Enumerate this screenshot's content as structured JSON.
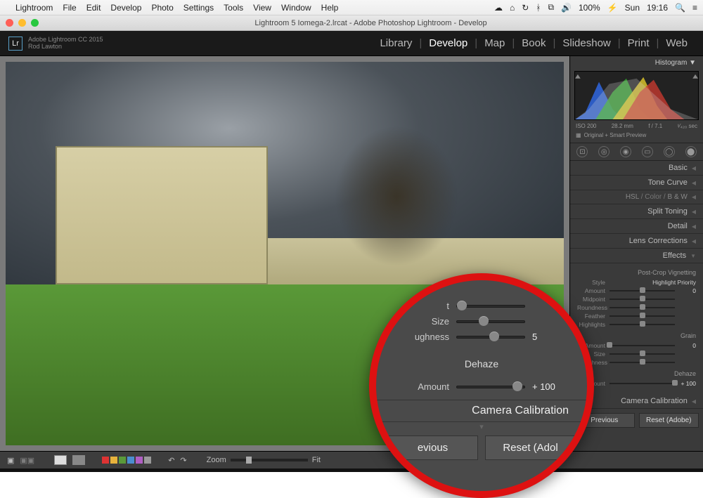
{
  "menubar": {
    "app": "Lightroom",
    "items": [
      "File",
      "Edit",
      "Develop",
      "Photo",
      "Settings",
      "Tools",
      "View",
      "Window",
      "Help"
    ],
    "status": {
      "battery": "100%",
      "battery_icon": "⚡",
      "day": "Sun",
      "time": "19:16"
    }
  },
  "window": {
    "title": "Lightroom 5 Iomega-2.lrcat - Adobe Photoshop Lightroom - Develop"
  },
  "identity": {
    "product_line": "Adobe Lightroom CC 2015",
    "user": "Rod Lawton",
    "logo_text": "Lr"
  },
  "modules": {
    "items": [
      "Library",
      "Develop",
      "Map",
      "Book",
      "Slideshow",
      "Print",
      "Web"
    ],
    "active": "Develop"
  },
  "right_panel": {
    "histogram": {
      "title": "Histogram",
      "meta": {
        "iso": "ISO 200",
        "focal": "28.2 mm",
        "aperture": "f / 7.1",
        "shutter": "¹⁄₄₂₀ sec"
      },
      "sub": "Original + Smart Preview"
    },
    "sections": [
      {
        "label": "Basic"
      },
      {
        "label": "Tone Curve"
      },
      {
        "label_prefix": "HSL",
        "label_mid": " / Color / ",
        "label_suffix": "B & W"
      },
      {
        "label": "Split Toning"
      },
      {
        "label": "Detail"
      },
      {
        "label": "Lens Corrections"
      }
    ],
    "effects": {
      "title": "Effects",
      "vignette": {
        "heading": "Post-Crop Vignetting",
        "style_label": "Style",
        "style_value": "Highlight Priority",
        "rows": [
          {
            "name": "Amount",
            "value": "0",
            "pos": 50
          },
          {
            "name": "Midpoint",
            "value": "",
            "pos": 50
          },
          {
            "name": "Roundness",
            "value": "",
            "pos": 50
          },
          {
            "name": "Feather",
            "value": "",
            "pos": 50
          },
          {
            "name": "Highlights",
            "value": "",
            "pos": 50
          }
        ]
      },
      "grain": {
        "heading": "Grain",
        "rows": [
          {
            "name": "Amount",
            "value": "0",
            "pos": 0
          },
          {
            "name": "Size",
            "value": "",
            "pos": 50
          },
          {
            "name": "Roughness",
            "value": "",
            "pos": 50
          }
        ]
      },
      "dehaze": {
        "heading": "Dehaze",
        "rows": [
          {
            "name": "Amount",
            "value": "+ 100",
            "pos": 100
          }
        ]
      }
    },
    "camera_cal": "Camera Calibration",
    "buttons": {
      "previous": "Previous",
      "reset": "Reset (Adobe)"
    }
  },
  "bottom": {
    "zoom_label": "Zoom",
    "fit_label": "Fit",
    "rating_colors": [
      "#d33",
      "#e7b23c",
      "#5a9a3a",
      "#4b8ed0",
      "#b05fc4",
      "#999"
    ]
  },
  "magnifier": {
    "rows_top": [
      {
        "label": "t",
        "value": "",
        "pos": 10
      },
      {
        "label": "Size",
        "value": "",
        "pos": 40
      },
      {
        "label": "ughness",
        "value": "5",
        "pos": 55
      }
    ],
    "dehaze_heading": "Dehaze",
    "dehaze_row": {
      "label": "Amount",
      "value": "+ 100",
      "pos": 90
    },
    "camera_cal": "Camera Calibration",
    "btn_prev": "evious",
    "btn_reset": "Reset (Adol"
  }
}
